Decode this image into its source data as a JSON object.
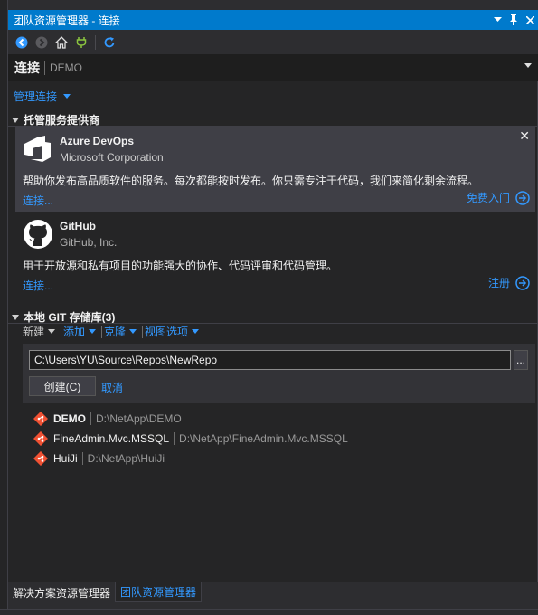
{
  "window": {
    "title": "团队资源管理器 - 连接"
  },
  "toolbar": {
    "buttons": [
      "back-icon",
      "forward-icon",
      "home-icon",
      "plug-icon",
      "refresh-icon"
    ]
  },
  "connect": {
    "title": "连接",
    "context": "DEMO",
    "manage_label": "管理连接"
  },
  "hosted": {
    "header": "托管服务提供商",
    "azure": {
      "name": "Azure DevOps",
      "org": "Microsoft Corporation",
      "description": "帮助你发布高品质软件的服务。每次都能按时发布。你只需专注于代码，我们来简化剩余流程。",
      "connect_label": "连接...",
      "action_label": "免费入门"
    },
    "github": {
      "name": "GitHub",
      "org": "GitHub, Inc.",
      "description": "用于开放源和私有项目的功能强大的协作、代码评审和代码管理。",
      "connect_label": "连接...",
      "action_label": "注册"
    }
  },
  "local_git": {
    "header": "本地 GIT 存储库(3)",
    "toolbar": {
      "new_label": "新建",
      "add_label": "添加",
      "clone_label": "克隆",
      "view_label": "视图选项"
    },
    "new_repo": {
      "path_value": "C:\\Users\\YU\\Source\\Repos\\NewRepo",
      "browse_label": "...",
      "create_label": "创建(C)",
      "cancel_label": "取消"
    },
    "repos": [
      {
        "name": "DEMO",
        "path": "D:\\NetApp\\DEMO",
        "bold": true
      },
      {
        "name": "FineAdmin.Mvc.MSSQL",
        "path": "D:\\NetApp\\FineAdmin.Mvc.MSSQL",
        "bold": false
      },
      {
        "name": "HuiJi",
        "path": "D:\\NetApp\\HuiJi",
        "bold": false
      }
    ]
  },
  "bottom_tabs": [
    {
      "label": "解决方案资源管理器",
      "active": false
    },
    {
      "label": "团队资源管理器",
      "active": true
    }
  ],
  "colors": {
    "accent": "#007acc",
    "link": "#3399ff",
    "background": "#252526",
    "git_icon": "#f05133"
  }
}
